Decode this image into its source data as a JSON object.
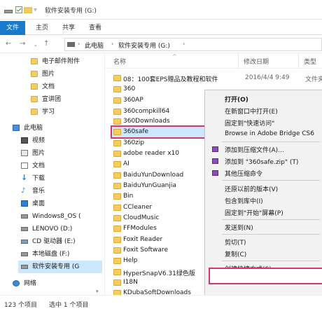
{
  "window": {
    "title": "软件安装专用 (G:)"
  },
  "ribbon": {
    "tabs": [
      "文件",
      "主页",
      "共享",
      "查看"
    ]
  },
  "address": {
    "crumbs": [
      "此电脑",
      "软件安装专用 (G:)"
    ]
  },
  "navpane": {
    "items": [
      {
        "label": "电子邮件附件",
        "icon": "folder-icon",
        "selected": false
      },
      {
        "label": "图片",
        "icon": "folder-icon",
        "selected": false
      },
      {
        "label": "文档",
        "icon": "folder-icon",
        "selected": false
      },
      {
        "label": "宣讲团",
        "icon": "folder-icon",
        "selected": false
      },
      {
        "label": "学习",
        "icon": "folder-icon",
        "selected": false
      },
      {
        "label": "此电脑",
        "icon": "pc-icon",
        "selected": false
      },
      {
        "label": "视频",
        "icon": "video-icon",
        "selected": false
      },
      {
        "label": "图片",
        "icon": "pictures-icon",
        "selected": false
      },
      {
        "label": "文档",
        "icon": "documents-icon",
        "selected": false
      },
      {
        "label": "下载",
        "icon": "download-icon",
        "selected": false
      },
      {
        "label": "音乐",
        "icon": "music-icon",
        "selected": false
      },
      {
        "label": "桌面",
        "icon": "desktop-icon",
        "selected": false
      },
      {
        "label": "Windows8_OS (",
        "icon": "drive-icon",
        "selected": false
      },
      {
        "label": "LENOVO (D:)",
        "icon": "drive-icon",
        "selected": false
      },
      {
        "label": "CD 驱动器 (E:)",
        "icon": "cd-drive-icon",
        "selected": false
      },
      {
        "label": "本地磁盘 (F:)",
        "icon": "drive-icon",
        "selected": false
      },
      {
        "label": "软件安装专用 (G",
        "icon": "drive-icon",
        "selected": true
      },
      {
        "label": "网络",
        "icon": "network-icon",
        "selected": false
      }
    ]
  },
  "columns": {
    "name": "名称",
    "date": "修改日期",
    "type": "类型"
  },
  "files": [
    {
      "name": "08：100套EPS赠品及教程和软件",
      "date": "2016/4/4 9:49",
      "type": "文件夹"
    },
    {
      "name": "360",
      "date": "",
      "type": ""
    },
    {
      "name": "360AP",
      "date": "",
      "type": ""
    },
    {
      "name": "360compkill64",
      "date": "",
      "type": ""
    },
    {
      "name": "360Downloads",
      "date": "",
      "type": ""
    },
    {
      "name": "360safe",
      "date": "",
      "type": ""
    },
    {
      "name": "360zip",
      "date": "",
      "type": ""
    },
    {
      "name": "adobe reader x10",
      "date": "",
      "type": ""
    },
    {
      "name": "AI",
      "date": "",
      "type": ""
    },
    {
      "name": "BaiduYunDownload",
      "date": "",
      "type": ""
    },
    {
      "name": "BaiduYunGuanjia",
      "date": "",
      "type": ""
    },
    {
      "name": "Bin",
      "date": "",
      "type": ""
    },
    {
      "name": "CCleaner",
      "date": "",
      "type": ""
    },
    {
      "name": "CloudMusic",
      "date": "",
      "type": ""
    },
    {
      "name": "FFModules",
      "date": "",
      "type": ""
    },
    {
      "name": "Foxit Reader",
      "date": "",
      "type": ""
    },
    {
      "name": "Foxit Software",
      "date": "",
      "type": ""
    },
    {
      "name": "Help",
      "date": "",
      "type": ""
    },
    {
      "name": "HyperSnapV6.31绿色版",
      "date": "",
      "type": ""
    },
    {
      "name": "I18N",
      "date": "",
      "type": ""
    },
    {
      "name": "KDubaSoftDownloads",
      "date": "",
      "type": ""
    }
  ],
  "context_menu": {
    "items": [
      "打开(O)",
      "在新窗口中打开(E)",
      "固定到\"快速访问\"",
      "Browse in Adobe Bridge CS6",
      "添加到压缩文件(A)...",
      "添加到 \"360safe.zip\" (T)",
      "其他压缩命令",
      "还原以前的版本(V)",
      "包含到库中(I)",
      "固定到\"开始\"屏幕(P)",
      "发送到(N)",
      "剪切(T)",
      "复制(C)",
      "创建快捷方式(S)"
    ]
  },
  "status": {
    "count": "123 个项目",
    "selected": "选中 1 个项目"
  },
  "colors": {
    "accent": "#1979ca",
    "selection": "#cce8ff",
    "highlight_border": "#d9366b",
    "folder": "#f4cf5f"
  }
}
